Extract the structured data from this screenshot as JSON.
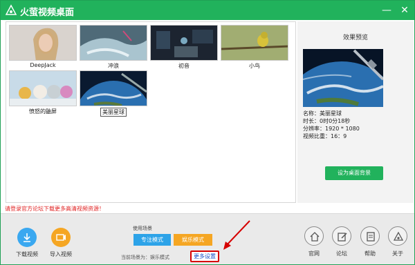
{
  "title": "火萤视频桌面",
  "window_controls": {
    "minimize": "—",
    "close": "✕"
  },
  "gallery": {
    "items": [
      {
        "label": "DeepJack",
        "icon": "portrait-image"
      },
      {
        "label": "冲浪",
        "icon": "surf-image"
      },
      {
        "label": "初音",
        "icon": "room-image"
      },
      {
        "label": "小鸟",
        "icon": "bird-image"
      },
      {
        "label": "愤怒的鼬屏",
        "icon": "birds-image"
      },
      {
        "label": "美丽星球",
        "icon": "earth-image",
        "selected": true
      }
    ]
  },
  "preview": {
    "title": "效果预览",
    "info": {
      "name": "名称：美丽星球",
      "duration": "时长：0时0分18秒",
      "resolution": "分辨率：1920 * 1080",
      "ratio": "视频比重：16：9"
    },
    "set_button": "设为桌面背景"
  },
  "notice": "请登录官方论坛下载更多高清视频资源！",
  "bottom": {
    "download_label": "下载视频",
    "import_label": "导入视频",
    "scene_label": "使用场景",
    "focus_mode": "专注模式",
    "fun_mode": "娱乐模式",
    "current_scene": "当前场景为：娱乐模式",
    "more_settings": "更多设置",
    "nav": [
      {
        "label": "官网",
        "icon": "home-icon"
      },
      {
        "label": "论坛",
        "icon": "edit-icon"
      },
      {
        "label": "帮助",
        "icon": "document-icon"
      },
      {
        "label": "关于",
        "icon": "logo-icon"
      }
    ]
  },
  "colors": {
    "brand": "#21b25c",
    "focus": "#2da3e8",
    "fun": "#f5a623",
    "notice": "#e02020",
    "highlight": "#d60000"
  }
}
